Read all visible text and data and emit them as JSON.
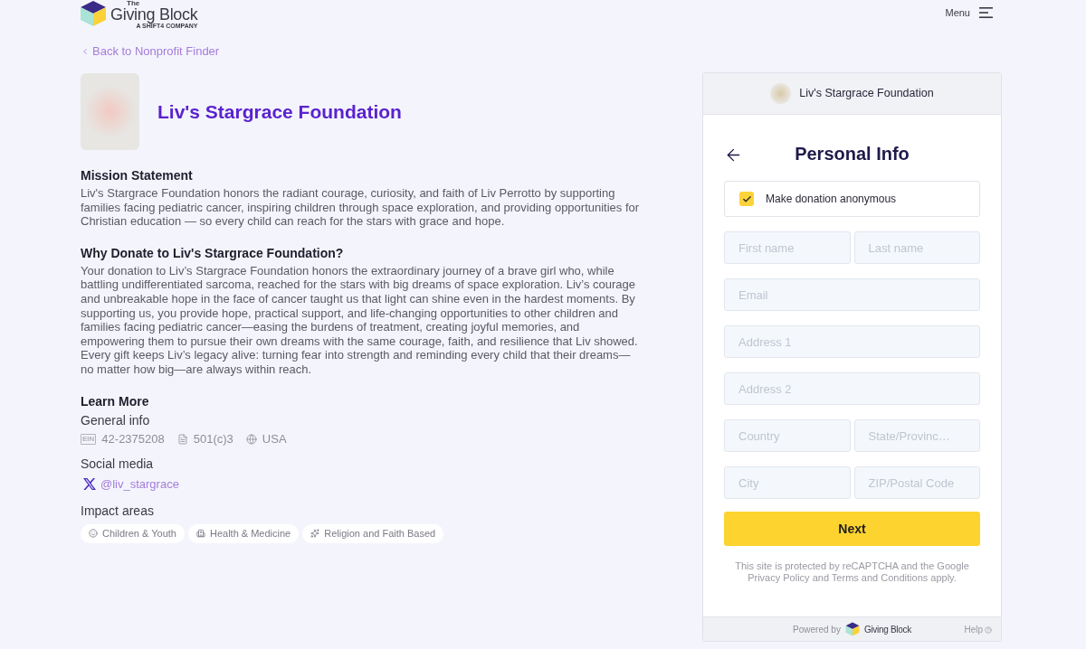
{
  "header": {
    "logo": {
      "top_word": "The",
      "name": "Giving Block",
      "tagline": "A SHIFT4 COMPANY"
    },
    "menu": "Menu"
  },
  "back_link": "Back to Nonprofit Finder",
  "organization": {
    "name": "Liv's Stargrace Foundation"
  },
  "sections": [
    {
      "heading": "Mission Statement",
      "body": "Liv's Stargrace Foundation honors the radiant courage, curiosity, and faith of Liv Perrotto by supporting families facing pediatric cancer, inspiring children through space exploration, and providing opportunities for Christian education — so every child can reach for the stars with grace and hope."
    },
    {
      "heading": "Why Donate to Liv's Stargrace Foundation?",
      "body": "Your donation to Liv’s Stargrace Foundation honors the extraordinary journey of a brave girl who, while battling undifferentiated sarcoma, reached for the stars with big dreams of space exploration. Liv’s courage and unbreakable hope in the face of cancer taught us that light can shine even in the hardest moments. By supporting us, you provide hope, practical support, and life-changing opportunities to other children and families facing pediatric cancer—easing the burdens of treatment, creating joyful memories, and empowering them to pursue their own dreams with the same courage, faith, and resilience that Liv showed. Every gift keeps Liv’s legacy alive: turning fear into strength and reminding every child that their dreams—no matter how big—are always within reach."
    }
  ],
  "learn_more": {
    "heading": "Learn More",
    "general_info": {
      "label": "General info",
      "items": [
        {
          "kind": "ein",
          "badge": "EIN",
          "value": "42-2375208"
        },
        {
          "kind": "tax_status",
          "value": "501(c)3"
        },
        {
          "kind": "country",
          "value": "USA"
        }
      ]
    },
    "social_media": {
      "label": "Social media",
      "links": [
        {
          "kind": "x",
          "handle": "@liv_stargrace"
        }
      ]
    },
    "impact_areas": {
      "label": "Impact areas",
      "tags": [
        {
          "kind": "children",
          "label": "Children & Youth"
        },
        {
          "kind": "health",
          "label": "Health & Medicine"
        },
        {
          "kind": "religion",
          "label": "Religion and Faith Based"
        }
      ]
    }
  },
  "donation_panel": {
    "org_name": "Liv's Stargrace Foundation",
    "title": "Personal Info",
    "anonymous": {
      "label": "Make donation anonymous",
      "checked": true
    },
    "field_rows": [
      {
        "fields": [
          {
            "placeholder": "First name"
          },
          {
            "placeholder": "Last name"
          }
        ]
      },
      {
        "fields": [
          {
            "placeholder": "Email"
          }
        ]
      },
      {
        "fields": [
          {
            "placeholder": "Address 1"
          }
        ]
      },
      {
        "fields": [
          {
            "placeholder": "Address 2"
          }
        ]
      },
      {
        "fields": [
          {
            "placeholder": "Country"
          },
          {
            "placeholder": "State/Provinc…"
          }
        ]
      },
      {
        "fields": [
          {
            "placeholder": "City"
          },
          {
            "placeholder": "ZIP/Postal Code"
          }
        ]
      }
    ],
    "next_button": "Next",
    "notice": "This site is protected by reCAPTCHA and the Google Privacy Policy and Terms and Conditions apply.",
    "footer": {
      "powered_by": "Powered by",
      "logo_name": "Giving Block",
      "help": "Help"
    }
  }
}
